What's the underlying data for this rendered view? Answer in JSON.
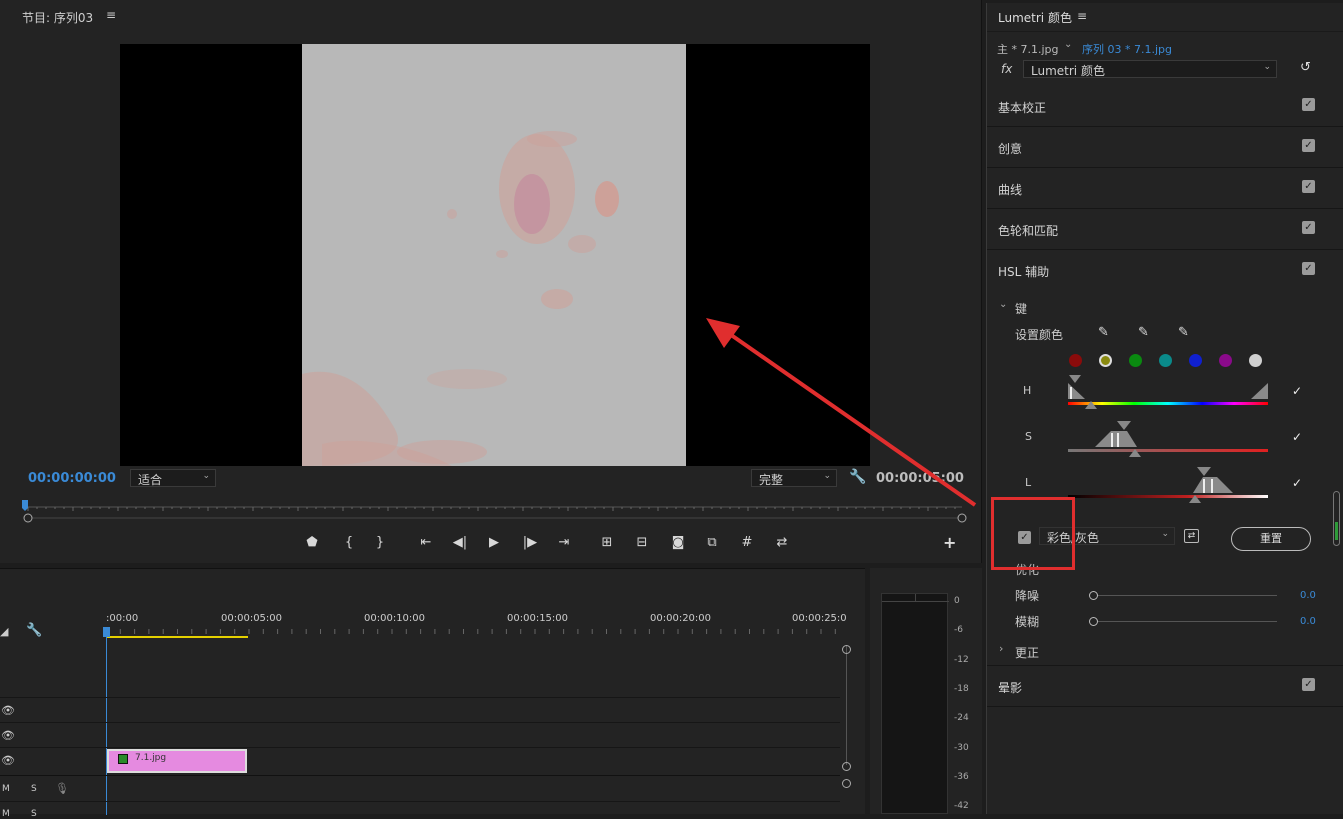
{
  "program_monitor": {
    "title": "节目: 序列03",
    "menu_icon": "≡",
    "timecode_left": "00:00:00:00",
    "timecode_right": "00:00:05:00",
    "fit_dropdown": "适合",
    "quality_dropdown": "完整",
    "wrench_icon": "wrench-icon"
  },
  "timeline": {
    "ruler_labels": [
      ":00:00",
      "00:00:05:00",
      "00:00:10:00",
      "00:00:15:00",
      "00:00:20:00",
      "00:00:25:0"
    ],
    "clip_name": "7.1.jpg",
    "track_labels": [
      "M",
      "S",
      "M",
      "S"
    ]
  },
  "audio_meter": {
    "ticks": [
      "0",
      "-6",
      "-12",
      "-18",
      "-24",
      "-30",
      "-36",
      "-42"
    ]
  },
  "lumetri": {
    "title": "Lumetri 颜色",
    "menu_icon": "≡",
    "master_clip": "主 * 7.1.jpg",
    "sequence_clip": "序列 03 * 7.1.jpg",
    "fx_label": "fx",
    "effect_dropdown": "Lumetri 颜色",
    "sections": [
      "基本校正",
      "创意",
      "曲线",
      "色轮和匹配",
      "HSL 辅助"
    ],
    "key_label": "键",
    "set_color_label": "设置颜色",
    "hsl_labels": [
      "H",
      "S",
      "L"
    ],
    "mask_dropdown": "彩色/灰色",
    "reset_button": "重置",
    "optimize_label": "优化",
    "denoise_label": "降噪",
    "denoise_value": "0.0",
    "blur_label": "模糊",
    "blur_value": "0.0",
    "correction_label": "更正",
    "vignette_label": "晕影"
  },
  "colors": {
    "accent_blue": "#3a8ad6",
    "clip_pink": "#e58ae0",
    "annotation_red": "#e02e2e",
    "playhead_yellow": "#e4d000"
  }
}
